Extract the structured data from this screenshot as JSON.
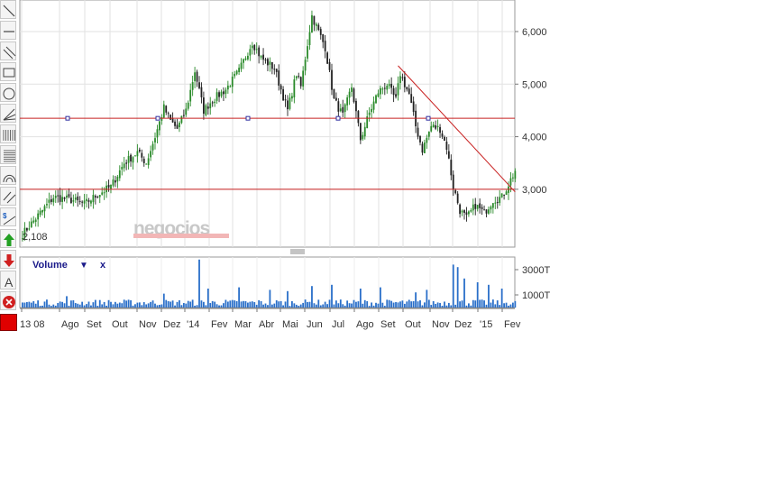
{
  "toolbar": {
    "tools": [
      {
        "name": "line-tool-icon"
      },
      {
        "name": "horizontal-line-tool-icon"
      },
      {
        "name": "parallel-lines-tool-icon"
      },
      {
        "name": "rectangle-tool-icon"
      },
      {
        "name": "ellipse-tool-icon"
      },
      {
        "name": "fan-tool-icon"
      },
      {
        "name": "fibonacci-vertical-tool-icon"
      },
      {
        "name": "fibonacci-horizontal-tool-icon"
      },
      {
        "name": "arc-tool-icon"
      },
      {
        "name": "channel-tool-icon"
      },
      {
        "name": "dollar-trend-tool-icon"
      },
      {
        "name": "buy-arrow-up-icon"
      },
      {
        "name": "sell-arrow-down-icon"
      },
      {
        "name": "text-tool-icon"
      },
      {
        "name": "delete-drawing-icon"
      }
    ],
    "color_swatch": "#e00000"
  },
  "chart_data": [
    {
      "type": "candlestick",
      "title": "",
      "last_value_label": "2,108",
      "watermark": "negocios",
      "y_ticks": [
        "3,000",
        "4,000",
        "5,000",
        "6,000"
      ],
      "ylim": [
        1900,
        6600
      ],
      "grid": true,
      "colors": {
        "up": "#2a8a2a",
        "down": "#222222",
        "drawing": "#c82020",
        "grid": "#e2e2e2"
      },
      "series": [
        {
          "name": "price",
          "anchors": [
            [
              0,
              2150
            ],
            [
              6,
              2450
            ],
            [
              14,
              2850
            ],
            [
              22,
              2800
            ],
            [
              28,
              2720
            ],
            [
              34,
              2900
            ],
            [
              40,
              3050
            ],
            [
              46,
              3500
            ],
            [
              52,
              3700
            ],
            [
              56,
              3500
            ],
            [
              60,
              4000
            ],
            [
              64,
              4550
            ],
            [
              67,
              4300
            ],
            [
              70,
              4150
            ],
            [
              74,
              4500
            ],
            [
              78,
              5250
            ],
            [
              82,
              4500
            ],
            [
              86,
              4700
            ],
            [
              92,
              4900
            ],
            [
              98,
              5250
            ],
            [
              104,
              5800
            ],
            [
              108,
              5500
            ],
            [
              114,
              5300
            ],
            [
              120,
              4500
            ],
            [
              124,
              5200
            ],
            [
              126,
              4950
            ],
            [
              128,
              5500
            ],
            [
              131,
              6300
            ],
            [
              134,
              6000
            ],
            [
              137,
              5700
            ],
            [
              141,
              4700
            ],
            [
              145,
              4400
            ],
            [
              149,
              4950
            ],
            [
              153,
              3950
            ],
            [
              157,
              4450
            ],
            [
              161,
              4850
            ],
            [
              165,
              5000
            ],
            [
              169,
              4700
            ],
            [
              171,
              5200
            ],
            [
              175,
              4800
            ],
            [
              178,
              4200
            ],
            [
              181,
              3750
            ],
            [
              185,
              4200
            ],
            [
              189,
              4150
            ],
            [
              192,
              3800
            ],
            [
              195,
              3050
            ],
            [
              198,
              2600
            ],
            [
              201,
              2450
            ],
            [
              205,
              2700
            ],
            [
              209,
              2550
            ],
            [
              213,
              2800
            ],
            [
              217,
              2850
            ],
            [
              220,
              3100
            ],
            [
              223,
              3350
            ]
          ]
        }
      ],
      "drawings": {
        "horizontal_lines": [
          4350,
          3000
        ],
        "trend_line": {
          "from": [
            170,
            5350
          ],
          "to": [
            223,
            2950
          ]
        }
      },
      "x_ticks": [
        "13 08",
        "Ago",
        "Set",
        "Out",
        "Nov",
        "Dez",
        "'14",
        "Fev",
        "Mar",
        "Abr",
        "Mai",
        "Jun",
        "Jul",
        "Ago",
        "Set",
        "Out",
        "Nov",
        "Dez",
        "'15",
        "Fev"
      ]
    },
    {
      "type": "bar",
      "title": "",
      "legend": {
        "label": "Volume",
        "dropdown": "▼",
        "close": "x"
      },
      "y_ticks": [
        "1000T",
        "3000T"
      ],
      "ylim": [
        0,
        4000
      ],
      "bar_color": "#2a6fc9",
      "base_volume": 320,
      "spikes": [
        [
          20,
          900
        ],
        [
          64,
          1100
        ],
        [
          80,
          3800
        ],
        [
          84,
          1500
        ],
        [
          98,
          1600
        ],
        [
          112,
          1400
        ],
        [
          120,
          1300
        ],
        [
          131,
          1700
        ],
        [
          140,
          1800
        ],
        [
          153,
          1500
        ],
        [
          162,
          1600
        ],
        [
          178,
          1200
        ],
        [
          183,
          1400
        ],
        [
          195,
          3400
        ],
        [
          197,
          3200
        ],
        [
          200,
          2300
        ],
        [
          206,
          2000
        ],
        [
          211,
          1800
        ],
        [
          217,
          1500
        ]
      ]
    }
  ]
}
